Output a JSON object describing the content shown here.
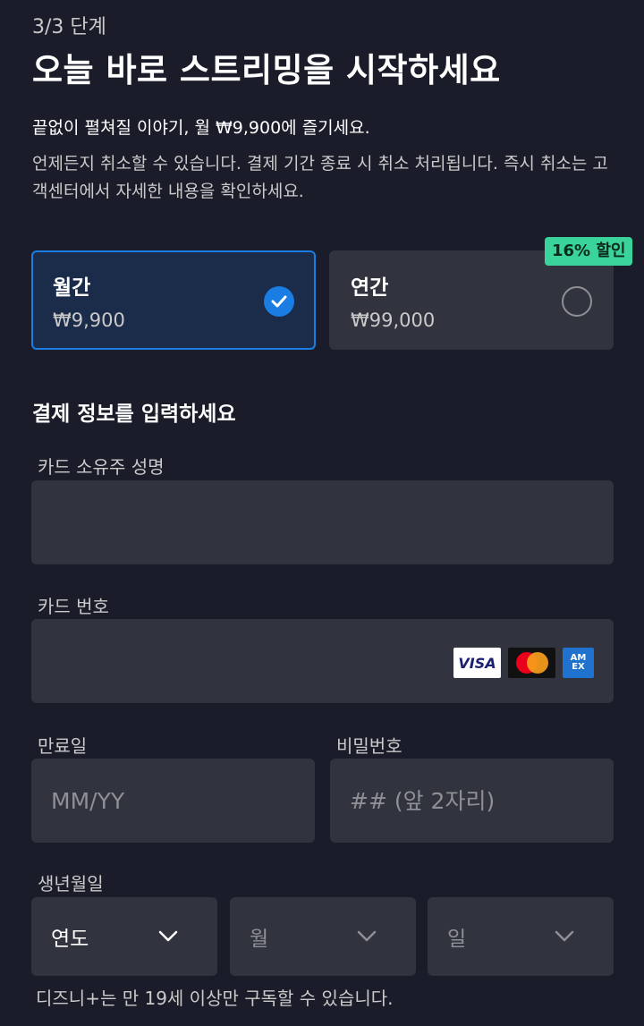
{
  "step": "3/3 단계",
  "title": "오늘 바로 스트리밍을 시작하세요",
  "lead": "끝없이 펼쳐질 이야기, 월 ₩9,900에 즐기세요.",
  "description": "언제든지 취소할 수 있습니다. 결제 기간 종료 시 취소 처리됩니다. 즉시 취소는 고객센터에서 자세한 내용을 확인하세요.",
  "plans": [
    {
      "name": "월간",
      "price": "₩9,900",
      "selected": true
    },
    {
      "name": "연간",
      "price": "₩99,000",
      "selected": false,
      "badge": "16% 할인"
    }
  ],
  "payment": {
    "section_title": "결제 정보를 입력하세요",
    "cardholder_label": "카드 소유주 성명",
    "cardholder_value": "",
    "card_number_label": "카드 번호",
    "card_number_value": "",
    "card_brands": [
      "VISA",
      "Mastercard",
      "AMEX"
    ],
    "expiry_label": "만료일",
    "expiry_placeholder": "MM/YY",
    "password_label": "비밀번호",
    "password_placeholder": "## (앞 2자리)"
  },
  "birthdate": {
    "label": "생년월일",
    "year": "연도",
    "month": "월",
    "day": "일"
  },
  "footnote": "디즈니+는 만 19세 이상만 구독할 수 있습니다.",
  "colors": {
    "background": "#1a1c29",
    "field": "#31343e",
    "accent": "#1a7de4",
    "badge": "#3ad39a"
  },
  "icons": {
    "selected": "check-circle-icon",
    "unselected": "radio-empty-icon",
    "dropdown": "chevron-down-icon"
  }
}
